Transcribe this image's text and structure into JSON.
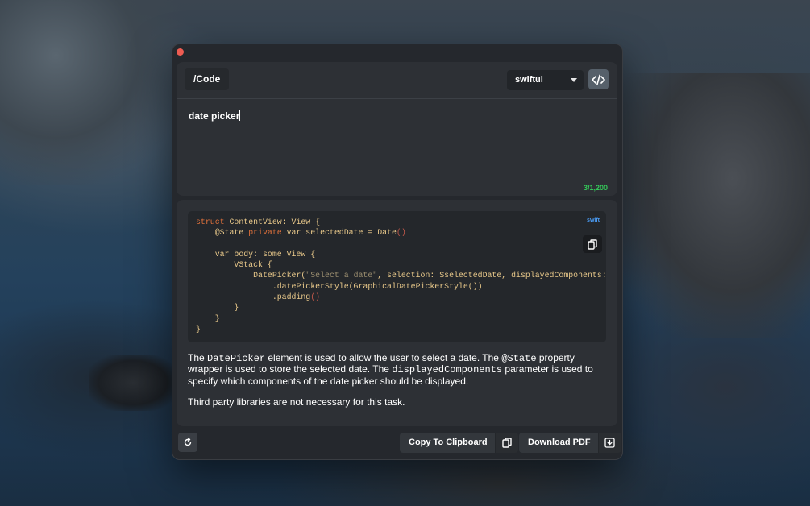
{
  "app": {
    "header": {
      "title": "/Code",
      "language_selected": "swiftui"
    },
    "prompt": {
      "text": "date picker",
      "char_count": "3/1,200"
    },
    "code_block": {
      "language_label": "swift",
      "lines": [
        "struct ContentView: View {",
        "    @State private var selectedDate = Date()",
        "",
        "    var body: some View {",
        "        VStack {",
        "            DatePicker(\"Select a date\", selection: $selectedDate, displayedComponents:",
        "                .datePickerStyle(GraphicalDatePickerStyle())",
        "                .padding()",
        "        }",
        "    }",
        "}"
      ]
    },
    "description": {
      "p1_t1": "The ",
      "p1_c1": "DatePicker",
      "p1_t2": " element is used to allow the user to select a date. The ",
      "p1_c2": "@State",
      "p1_t3": " property wrapper is used to store the selected date. The ",
      "p1_c3": "displayedComponents",
      "p1_t4": " parameter is used to specify which components of the date picker should be displayed.",
      "p2": "Third party libraries are not necessary for this task."
    },
    "footer": {
      "copy_label": "Copy To Clipboard",
      "download_label": "Download PDF"
    },
    "icons": {
      "close": "close-icon",
      "code_toggle": "code-brackets-icon",
      "dropdown": "chevron-down-icon",
      "copy": "clipboard-icon",
      "refresh": "refresh-icon",
      "download": "download-icon"
    },
    "colors": {
      "accent_green": "#34c759",
      "lang_label_blue": "#4a9cf5",
      "close_red": "#ee5c52"
    }
  }
}
